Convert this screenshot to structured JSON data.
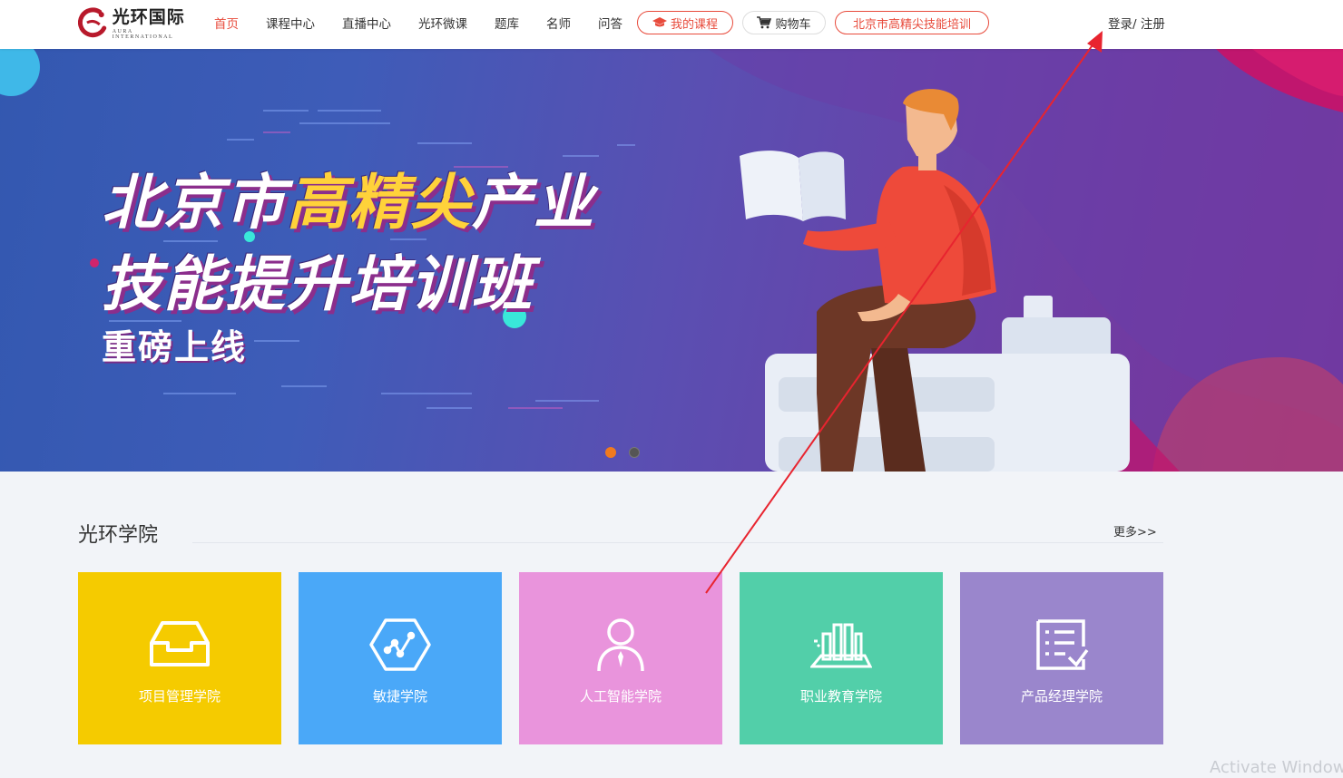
{
  "brand": {
    "name_cn": "光环国际",
    "name_en": "AURA INTERNATIONAL",
    "accent_color": "#e84b3c"
  },
  "nav": {
    "items": [
      {
        "label": "首页",
        "active": true
      },
      {
        "label": "课程中心"
      },
      {
        "label": "直播中心"
      },
      {
        "label": "光环微课"
      },
      {
        "label": "题库"
      },
      {
        "label": "名师"
      },
      {
        "label": "问答"
      }
    ],
    "my_courses": {
      "label": "我的课程",
      "icon": "graduation-cap-icon"
    },
    "cart": {
      "label": "购物车",
      "icon": "cart-icon"
    },
    "training": {
      "label": "北京市高精尖技能培训"
    },
    "login": "登录/ 注册"
  },
  "banner": {
    "title_line1_pre": "北京市",
    "title_line1_highlight": "高精尖",
    "title_line1_post": "产业",
    "title_line2": "技能提升培训班",
    "subtitle": "重磅上线",
    "slide_count": 2,
    "active_slide": 1
  },
  "section": {
    "title": "光环学院",
    "more": "更多>>"
  },
  "colleges": [
    {
      "label": "项目管理学院",
      "color": "#f5cb00",
      "icon": "inbox-tray-icon"
    },
    {
      "label": "敏捷学院",
      "color": "#4aa8f8",
      "icon": "hexagon-chart-icon"
    },
    {
      "label": "人工智能学院",
      "color": "#e994dc",
      "icon": "person-tie-icon"
    },
    {
      "label": "职业教育学院",
      "color": "#52cfa9",
      "icon": "bookshelf-icon"
    },
    {
      "label": "产品经理学院",
      "color": "#9a86cc",
      "icon": "checklist-icon"
    }
  ],
  "watermark": "Activate Window"
}
